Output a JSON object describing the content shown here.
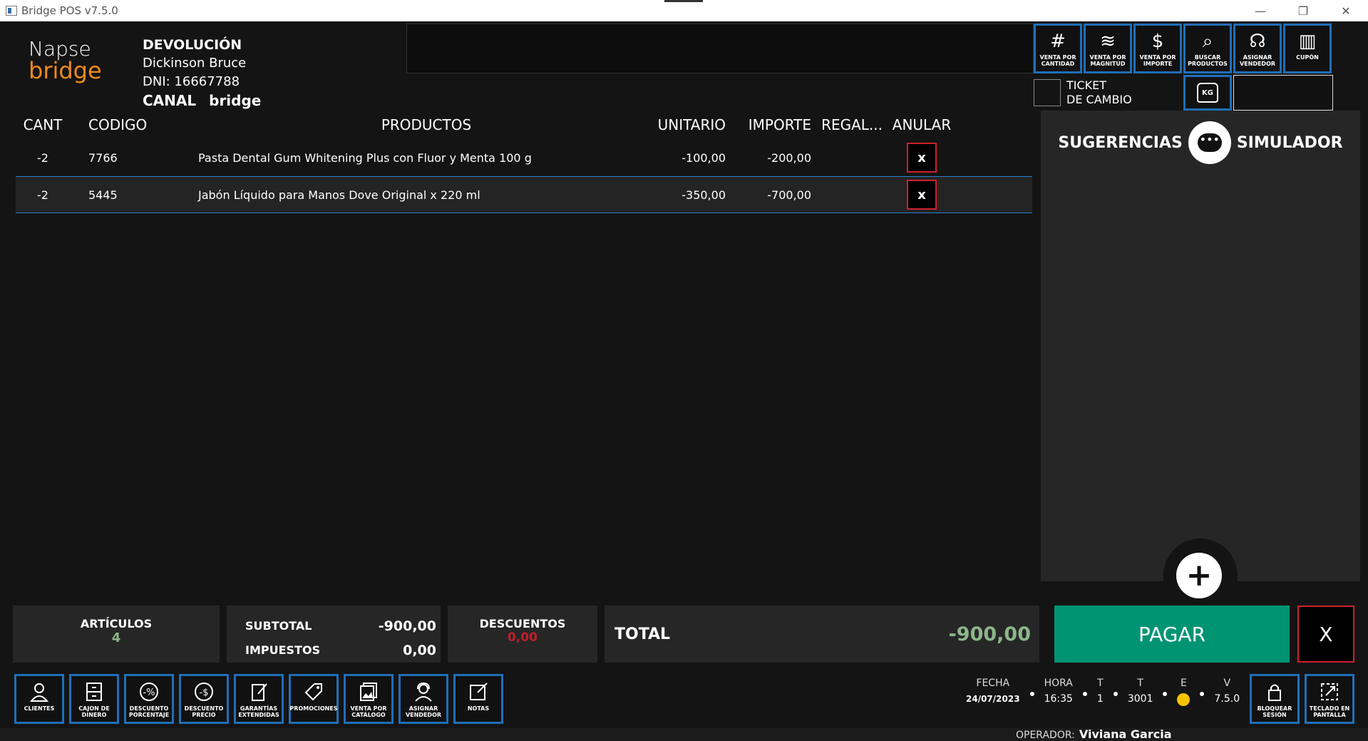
{
  "window": {
    "title": "Bridge POS v7.5.0",
    "minimize": "—",
    "restore": "❐",
    "close": "✕"
  },
  "logo": {
    "line1": "Napse",
    "line2": "bridge"
  },
  "customer": {
    "mode": "DEVOLUCIÓN",
    "name": "Dickinson Bruce",
    "dni": "DNI: 16667788",
    "canal_label": "CANAL",
    "canal_value": "bridge"
  },
  "top_buttons": [
    {
      "icon": "#",
      "label": "VENTA POR CANTIDAD",
      "name": "hash-icon"
    },
    {
      "icon": "≋",
      "label": "VENTA POR MAGNITUD",
      "name": "layers-icon"
    },
    {
      "icon": "$",
      "label": "VENTA POR IMPORTE",
      "name": "dollar-icon"
    },
    {
      "icon": "⌕",
      "label": "BUSCAR PRODUCTOS",
      "name": "search-icon"
    },
    {
      "icon": "☊",
      "label": "ASIGNAR VENDEDOR",
      "name": "headset-icon"
    },
    {
      "icon": "▥",
      "label": "CUPÓN",
      "name": "barcode-icon"
    }
  ],
  "ticket": {
    "line1": "TICKET",
    "line2": "DE CAMBIO"
  },
  "kg_label": "KG",
  "table": {
    "headers": {
      "cant": "CANT",
      "codigo": "CODIGO",
      "productos": "PRODUCTOS",
      "unitario": "UNITARIO",
      "importe": "IMPORTE",
      "regalo": "REGAL...",
      "anular": "ANULAR"
    },
    "rows": [
      {
        "cant": "-2",
        "codigo": "7766",
        "producto": "Pasta Dental Gum Whitening Plus con Fluor y Menta 100 g",
        "unitario": "-100,00",
        "importe": "-200,00",
        "anular": "x"
      },
      {
        "cant": "-2",
        "codigo": "5445",
        "producto": "Jabón Líquido para Manos Dove Original x 220 ml",
        "unitario": "-350,00",
        "importe": "-700,00",
        "anular": "x"
      }
    ]
  },
  "side": {
    "tab1": "SUGERENCIAS",
    "tab2": "SIMULADOR",
    "chat": "•••",
    "add": "+"
  },
  "summary": {
    "articulos_label": "ARTÍCULOS",
    "articulos_value": "4",
    "subtotal_label": "SUBTOTAL",
    "subtotal_value": "-900,00",
    "impuestos_label": "IMPUESTOS",
    "impuestos_value": "0,00",
    "descuentos_label": "DESCUENTOS",
    "descuentos_value": "0,00",
    "total_label": "TOTAL",
    "total_value": "-900,00"
  },
  "pay_label": "PAGAR",
  "cancel_label": "X",
  "bottom_buttons": [
    {
      "label": "CLIENTES",
      "name": "clientes-button"
    },
    {
      "label": "CAJON DE DINERO",
      "name": "cajon-button"
    },
    {
      "label": "DESCUENTO PORCENTAJE",
      "name": "descuento-porcentaje-button"
    },
    {
      "label": "DESCUENTO PRECIO",
      "name": "descuento-precio-button"
    },
    {
      "label": "GARANTÍAS EXTENDIDAS",
      "name": "garantias-button"
    },
    {
      "label": "PROMOCIONES",
      "name": "promociones-button"
    },
    {
      "label": "VENTA POR CATÁLOGO",
      "name": "catalogo-button"
    },
    {
      "label": "ASIGNAR VENDEDOR",
      "name": "asignar-vendedor-button"
    },
    {
      "label": "NOTAS",
      "name": "notas-button"
    }
  ],
  "status": {
    "fecha_label": "FECHA",
    "fecha_value": "24/07/2023",
    "hora_label": "HORA",
    "hora_value": "16:35",
    "t1_label": "T",
    "t1_value": "1",
    "t2_label": "T",
    "t2_value": "3001",
    "e_label": "E",
    "v_label": "V",
    "v_value": "7.5.0",
    "operador_label": "OPERADOR:",
    "operador_value": "Viviana Garcia"
  },
  "right_buttons": [
    {
      "label": "BLOQUEAR SESIÓN"
    },
    {
      "label": "TECLADO EN PANTALLA"
    }
  ],
  "colors": {
    "accent_blue": "#1f6fb8",
    "pay_green": "#009473",
    "danger_red": "#d01f2e",
    "total_green": "#8db68a",
    "brand_orange": "#f08a1c"
  }
}
